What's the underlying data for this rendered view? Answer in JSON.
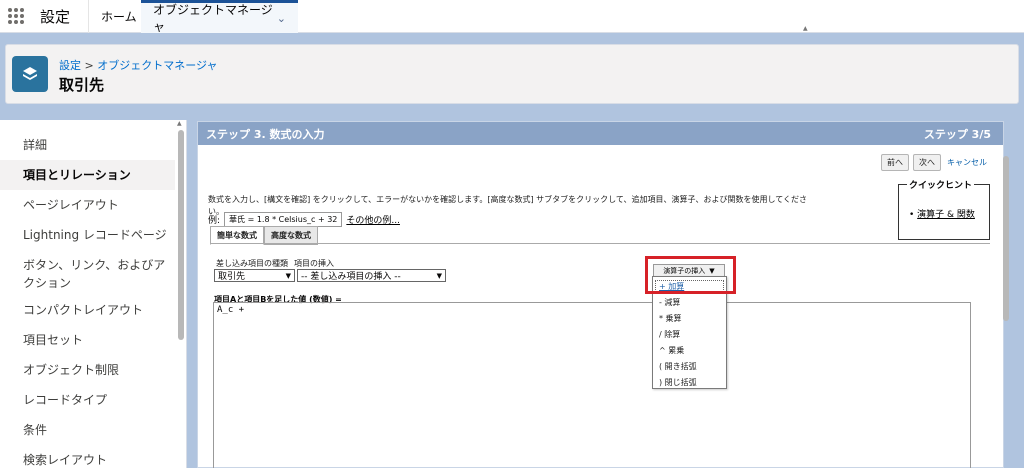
{
  "topnav": {
    "app_name": "設定",
    "tabs": [
      {
        "label": "ホーム"
      },
      {
        "label": "オブジェクトマネージャ"
      }
    ]
  },
  "header": {
    "breadcrumb_setup": "設定",
    "breadcrumb_sep": ">",
    "breadcrumb_om": "オブジェクトマネージャ",
    "title": "取引先"
  },
  "sidebar": {
    "items": [
      {
        "label": "詳細"
      },
      {
        "label": "項目とリレーション"
      },
      {
        "label": "ページレイアウト"
      },
      {
        "label": "Lightning レコードページ"
      },
      {
        "label": "ボタン、リンク、およびア"
      },
      {
        "label": "クション"
      },
      {
        "label": "コンパクトレイアウト"
      },
      {
        "label": "項目セット"
      },
      {
        "label": "オブジェクト制限"
      },
      {
        "label": "レコードタイプ"
      },
      {
        "label": "条件"
      },
      {
        "label": "検索レイアウト"
      }
    ]
  },
  "main": {
    "step_title": "ステップ 3. 数式の入力",
    "step_count": "ステップ 3/5",
    "buttons": {
      "prev": "前へ",
      "next": "次へ",
      "cancel": "キャンセル"
    },
    "description": "数式を入力し、[構文を確認] をクリックして、エラーがないかを確認します。[高度な数式] サブタブをクリックして、追加項目、演算子、および関数を使用してください。",
    "example_label": "例:",
    "example_formula": "華氏 = 1.8 * Celsius_c + 32",
    "more_examples": "その他の例...",
    "quickhint": {
      "title": "クイックヒント",
      "item": "演算子 & 関数"
    },
    "subtabs": [
      {
        "label": "簡単な数式"
      },
      {
        "label": "高度な数式"
      }
    ],
    "merge_type_label": "差し込み項目の種類",
    "merge_insert_label": "項目の挿入",
    "merge_type_value": "取引先",
    "merge_insert_value": "-- 差し込み項目の挿入 --",
    "operator_button": "演算子の挿入",
    "formula_label": "項目Aと項目Bを足した値 (数値) =",
    "formula_value": "A_c +",
    "operators": [
      {
        "label": "+ 加算"
      },
      {
        "label": "- 減算"
      },
      {
        "label": "* 乗算"
      },
      {
        "label": "/ 除算"
      },
      {
        "label": "^ 累乗"
      },
      {
        "label": "( 開き括弧"
      },
      {
        "label": ") 閉じ括弧"
      }
    ]
  },
  "colors": {
    "band": "#b0c4df",
    "step_bar": "#8aa3c6",
    "highlight": "#d62128",
    "object_icon": "#2a739e"
  }
}
